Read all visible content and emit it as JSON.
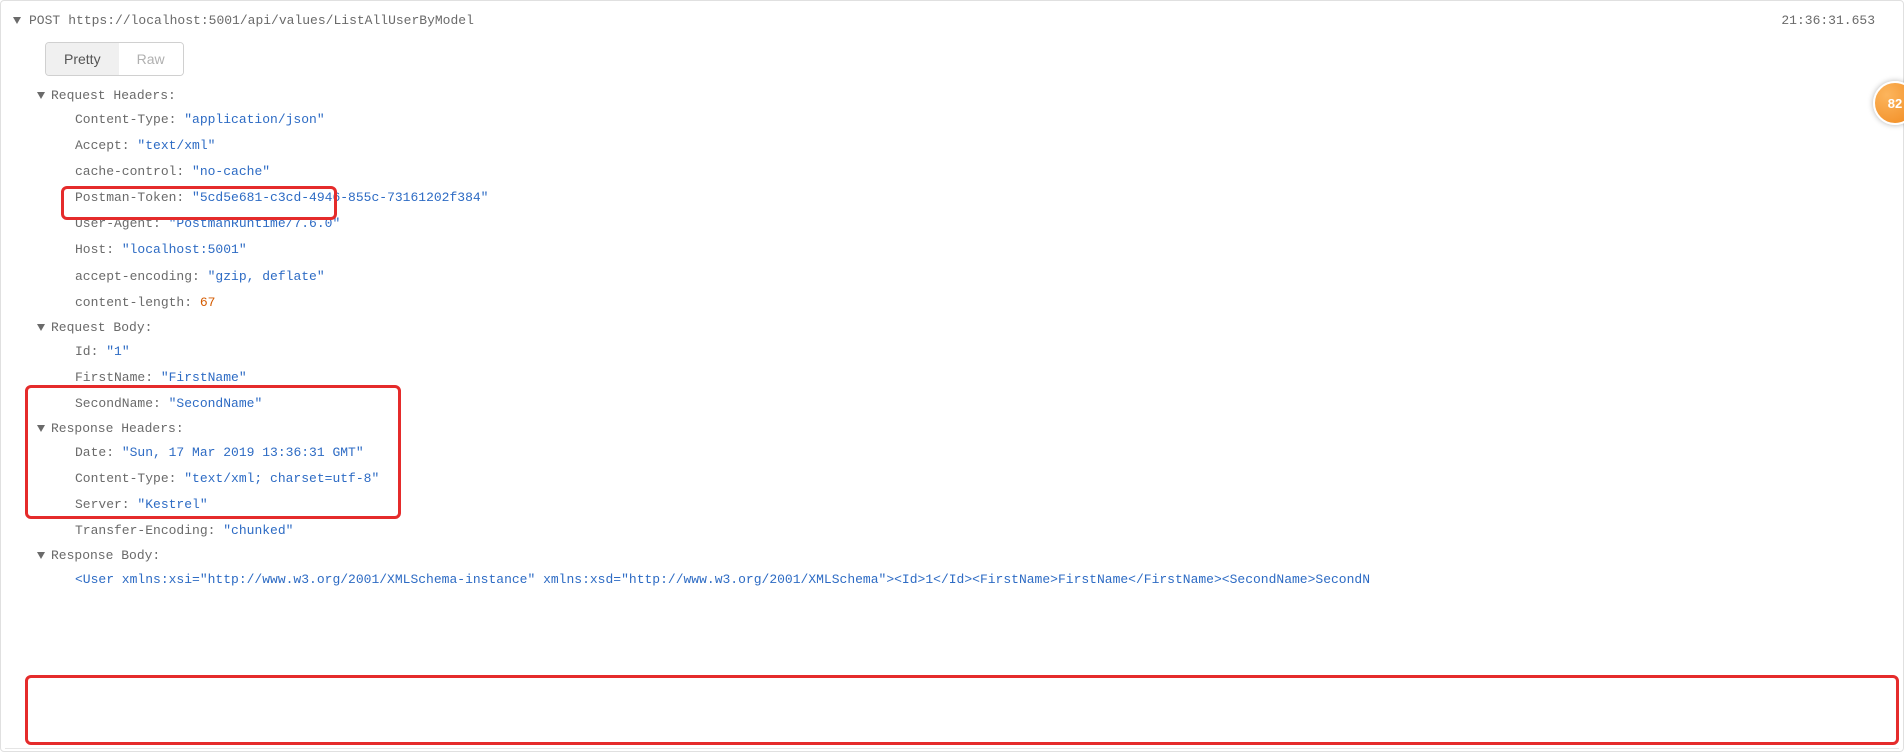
{
  "request": {
    "method": "POST",
    "url": "https://localhost:5001/api/values/ListAllUserByModel"
  },
  "timestamp": "21:36:31.653",
  "tabs": {
    "pretty": "Pretty",
    "raw": "Raw"
  },
  "req_headers": {
    "title": "Request Headers:",
    "items": [
      {
        "k": "Content-Type:",
        "v": "\"application/json\"",
        "t": "str"
      },
      {
        "k": "Accept:",
        "v": "\"text/xml\"",
        "t": "str"
      },
      {
        "k": "cache-control:",
        "v": "\"no-cache\"",
        "t": "str"
      },
      {
        "k": "Postman-Token:",
        "v": "\"5cd5e681-c3cd-4946-855c-73161202f384\"",
        "t": "str"
      },
      {
        "k": "User-Agent:",
        "v": "\"PostmanRuntime/7.6.0\"",
        "t": "str"
      },
      {
        "k": "Host:",
        "v": "\"localhost:5001\"",
        "t": "str"
      },
      {
        "k": "accept-encoding:",
        "v": "\"gzip, deflate\"",
        "t": "str"
      },
      {
        "k": "content-length:",
        "v": "67",
        "t": "num"
      }
    ]
  },
  "req_body": {
    "title": "Request Body:",
    "items": [
      {
        "k": "Id:",
        "v": "\"1\"",
        "t": "str"
      },
      {
        "k": "FirstName:",
        "v": "\"FirstName\"",
        "t": "str"
      },
      {
        "k": "SecondName:",
        "v": "\"SecondName\"",
        "t": "str"
      }
    ]
  },
  "res_headers": {
    "title": "Response Headers:",
    "items": [
      {
        "k": "Date:",
        "v": "\"Sun, 17 Mar 2019 13:36:31 GMT\"",
        "t": "str"
      },
      {
        "k": "Content-Type:",
        "v": "\"text/xml; charset=utf-8\"",
        "t": "str"
      },
      {
        "k": "Server:",
        "v": "\"Kestrel\"",
        "t": "str"
      },
      {
        "k": "Transfer-Encoding:",
        "v": "\"chunked\"",
        "t": "str"
      }
    ]
  },
  "res_body": {
    "title": "Response Body:",
    "content": "<User xmlns:xsi=\"http://www.w3.org/2001/XMLSchema-instance\" xmlns:xsd=\"http://www.w3.org/2001/XMLSchema\"><Id>1</Id><FirstName>FirstName</FirstName><SecondName>SecondN"
  },
  "badge": "82"
}
